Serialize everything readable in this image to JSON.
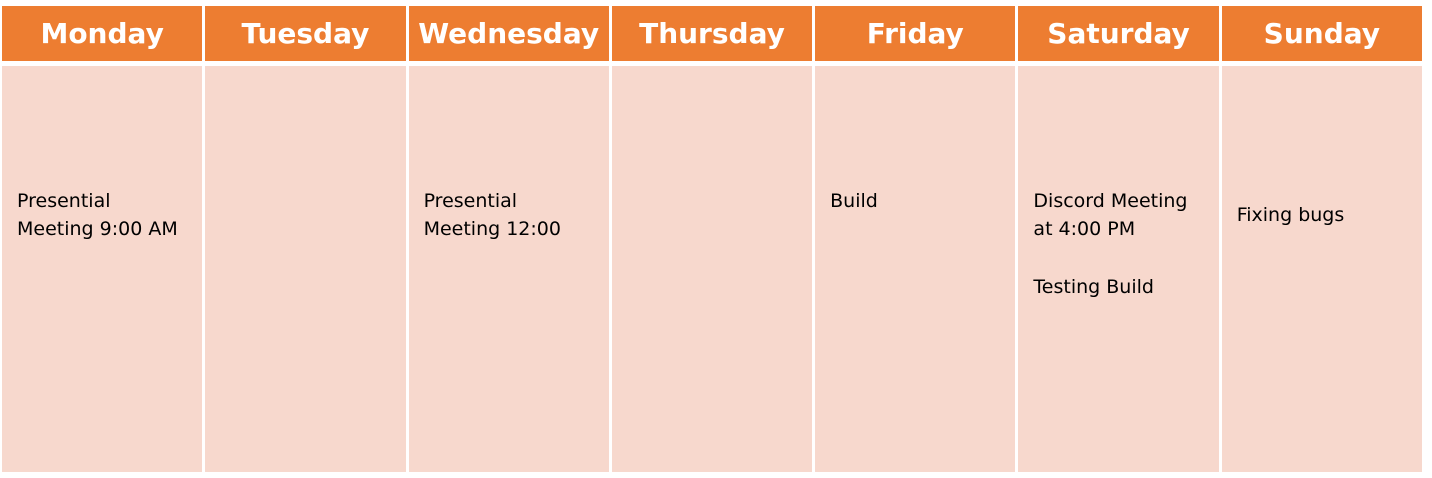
{
  "colors": {
    "header": "#ED7D31",
    "cell": "#F7D8CD"
  },
  "days": [
    {
      "name": "Monday",
      "entries": [
        "Presential Meeting 9:00 AM"
      ]
    },
    {
      "name": "Tuesday",
      "entries": []
    },
    {
      "name": "Wednesday",
      "entries": [
        "Presential Meeting 12:00"
      ]
    },
    {
      "name": "Thursday",
      "entries": []
    },
    {
      "name": "Friday",
      "entries": [
        "Build"
      ]
    },
    {
      "name": "Saturday",
      "entries": [
        "Discord Meeting at 4:00 PM",
        "Testing Build"
      ]
    },
    {
      "name": "Sunday",
      "entries": [
        "Fixing bugs"
      ]
    }
  ]
}
